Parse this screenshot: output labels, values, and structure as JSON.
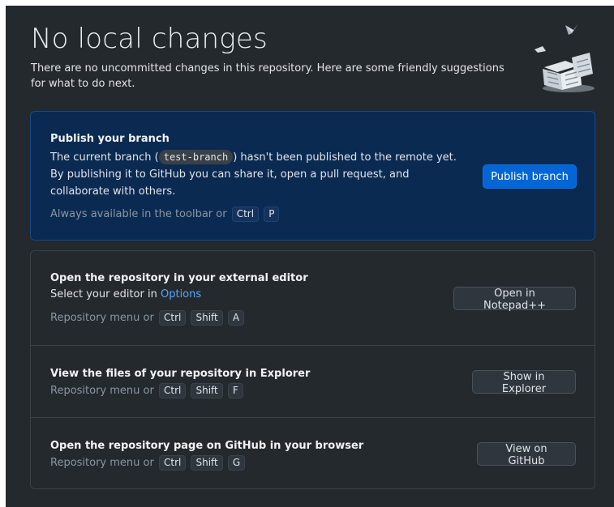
{
  "header": {
    "title": "No local changes",
    "description": "There are no uncommitted changes in this repository. Here are some friendly suggestions for what to do next."
  },
  "publish": {
    "title": "Publish your branch",
    "body_before": "The current branch (",
    "branch_name": "test-branch",
    "body_after": ") hasn't been published to the remote yet. By publishing it to GitHub you can share it, open a pull request, and collaborate with others.",
    "shortcut_text": "Always available in the toolbar or",
    "keys": [
      "Ctrl",
      "P"
    ],
    "button_label": "Publish branch"
  },
  "actions": [
    {
      "title": "Open the repository in your external editor",
      "subtitle_before": "Select your editor in ",
      "subtitle_link": "Options",
      "shortcut_text": "Repository menu or",
      "keys": [
        "Ctrl",
        "Shift",
        "A"
      ],
      "button_label": "Open in Notepad++"
    },
    {
      "title": "View the files of your repository in Explorer",
      "shortcut_text": "Repository menu or",
      "keys": [
        "Ctrl",
        "Shift",
        "F"
      ],
      "button_label": "Show in Explorer"
    },
    {
      "title": "Open the repository page on GitHub in your browser",
      "shortcut_text": "Repository menu or",
      "keys": [
        "Ctrl",
        "Shift",
        "G"
      ],
      "button_label": "View on GitHub"
    }
  ],
  "colors": {
    "background": "#24292e",
    "publish_background": "#0b2a52",
    "primary_button": "#0366d6",
    "link": "#58a6ff"
  },
  "icons": {
    "illustration": "empty-state-illustration-icon"
  }
}
